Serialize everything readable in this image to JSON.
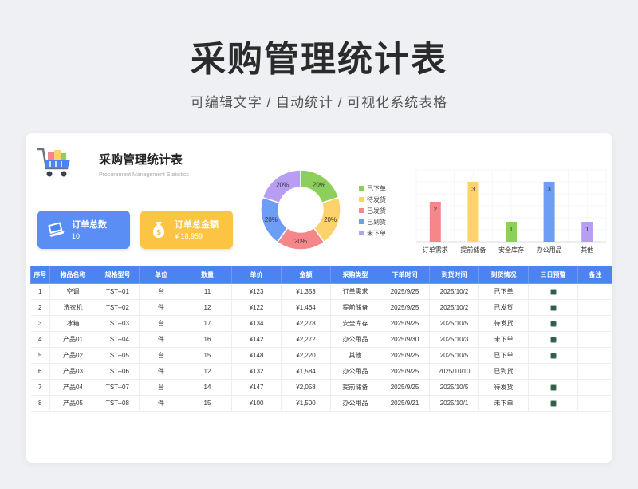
{
  "header": {
    "title": "采购管理统计表",
    "subtitle": "可编辑文字 / 自动统计 / 可视化系统表格"
  },
  "card": {
    "title": "采购管理统计表",
    "subtitle": "Procurement Management Statistics",
    "logo_icon": "shopping-cart-icon"
  },
  "kpis": [
    {
      "label": "订单总数",
      "value": "10",
      "icon": "laptop-icon",
      "color": "#5b8ef5"
    },
    {
      "label": "订单总金额",
      "value": "¥ 18,959",
      "icon": "money-bag-icon",
      "color": "#fbc543"
    }
  ],
  "colors": {
    "header_blue": "#4b83f0",
    "green": "#8cd05b",
    "yellow": "#fdd26a",
    "red": "#f5878a",
    "blue": "#6d9df4",
    "purple": "#b89ef2"
  },
  "chart_data": [
    {
      "type": "pie",
      "categories": [
        "已下单",
        "待发货",
        "已发货",
        "已到货",
        "未下单"
      ],
      "values": [
        20,
        20,
        20,
        20,
        20
      ],
      "labels": [
        "20%",
        "20%",
        "20%",
        "20%",
        "20%"
      ],
      "colors": [
        "#8cd05b",
        "#fdd26a",
        "#f5878a",
        "#6d9df4",
        "#b89ef2"
      ],
      "legend": "right"
    },
    {
      "type": "bar",
      "categories": [
        "订单需求",
        "提前储备",
        "安全库存",
        "办公用品",
        "其他"
      ],
      "values": [
        2,
        3,
        1,
        3,
        1
      ],
      "colors": [
        "#f5878a",
        "#fdd26a",
        "#8cd05b",
        "#6d9df4",
        "#b89ef2"
      ],
      "ylim": [
        0,
        3.6
      ],
      "grid": true
    }
  ],
  "table": {
    "headers": [
      "序号",
      "物品名称",
      "规格型号",
      "单位",
      "数量",
      "单价",
      "金额",
      "采购类型",
      "下单时间",
      "到货时间",
      "到货情况",
      "三日预警",
      "备注"
    ],
    "rows": [
      [
        "1",
        "空调",
        "TST--01",
        "台",
        "11",
        "¥123",
        "¥1,353",
        "订单需求",
        "2025/9/25",
        "2025/10/2",
        "已下单",
        "dot",
        ""
      ],
      [
        "2",
        "洗衣机",
        "TST--02",
        "件",
        "12",
        "¥122",
        "¥1,464",
        "提前储备",
        "2025/9/25",
        "2025/10/2",
        "已发货",
        "dot",
        ""
      ],
      [
        "3",
        "冰箱",
        "TST--03",
        "台",
        "17",
        "¥134",
        "¥2,278",
        "安全库存",
        "2025/9/25",
        "2025/10/5",
        "待发货",
        "dot",
        ""
      ],
      [
        "4",
        "产品01",
        "TST--04",
        "件",
        "16",
        "¥142",
        "¥2,272",
        "办公用品",
        "2025/9/30",
        "2025/10/3",
        "未下单",
        "dot",
        ""
      ],
      [
        "5",
        "产品02",
        "TST--05",
        "台",
        "15",
        "¥148",
        "¥2,220",
        "其他",
        "2025/9/25",
        "2025/10/5",
        "已下单",
        "dot",
        ""
      ],
      [
        "6",
        "产品03",
        "TST--06",
        "件",
        "12",
        "¥132",
        "¥1,584",
        "办公用品",
        "2025/9/25",
        "2025/10/10",
        "已到货",
        "",
        ""
      ],
      [
        "7",
        "产品04",
        "TST--07",
        "台",
        "14",
        "¥147",
        "¥2,058",
        "提前储备",
        "2025/9/25",
        "2025/10/5",
        "待发货",
        "dot",
        ""
      ],
      [
        "8",
        "产品05",
        "TST--08",
        "件",
        "15",
        "¥100",
        "¥1,500",
        "办公用品",
        "2025/9/21",
        "2025/10/1",
        "未下单",
        "dot",
        ""
      ]
    ]
  }
}
